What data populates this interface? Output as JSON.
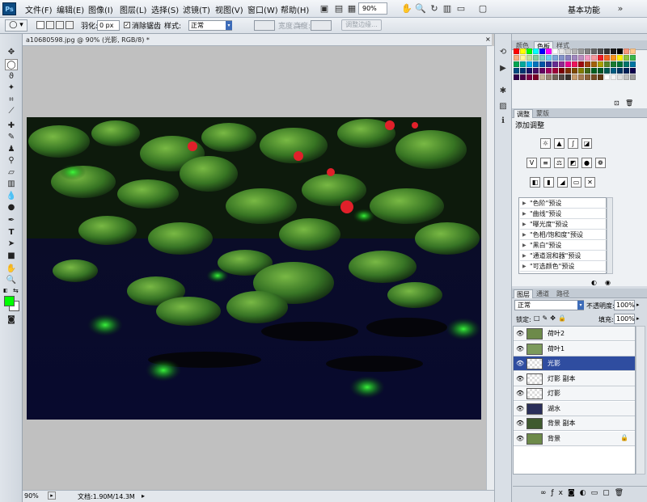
{
  "app": {
    "logo": "Ps"
  },
  "menu": [
    "文件(F)",
    "编辑(E)",
    "图像(I)",
    "图层(L)",
    "选择(S)",
    "滤镜(T)",
    "视图(V)",
    "窗口(W)",
    "帮助(H)"
  ],
  "toolbar": {
    "zoom": "90%",
    "workspace": "基本功能"
  },
  "options": {
    "feather_label": "羽化:",
    "feather_value": "0 px",
    "antialias_label": "消除锯齿",
    "style_label": "样式:",
    "style_value": "正常",
    "width_label": "宽度:",
    "height_label": "高度:",
    "refine_edge": "调整边缘..."
  },
  "document": {
    "tab_title": "a10680598.jpg @ 90% (光影, RGB/8) *",
    "status_zoom": "90%",
    "status_doc": "文档:1.90M/14.3M"
  },
  "panels": {
    "color_tabs": [
      "颜色",
      "色板",
      "样式"
    ],
    "adjust_tabs": [
      "调整",
      "蒙版"
    ],
    "adjust_title": "添加调整",
    "presets": [
      "\"色阶\"预设",
      "\"曲线\"预设",
      "\"曝光度\"预设",
      "\"色相/饱和度\"预设",
      "\"黑白\"预设",
      "\"通道混和器\"预设",
      "\"可选颜色\"预设"
    ],
    "layer_tabs": [
      "图层",
      "通道",
      "路径"
    ],
    "blend_mode": "正常",
    "opacity_label": "不透明度:",
    "opacity_value": "100%",
    "lock_label": "锁定:",
    "fill_label": "填充:",
    "fill_value": "100%"
  },
  "layers": [
    {
      "name": "荷叶2",
      "thumb": "#6d8a4a",
      "selected": false
    },
    {
      "name": "荷叶1",
      "thumb": "#7c9a5c",
      "selected": false
    },
    {
      "name": "光影",
      "thumb": "checker",
      "selected": true
    },
    {
      "name": "灯影 副本",
      "thumb": "checker",
      "selected": false
    },
    {
      "name": "灯影",
      "thumb": "checker",
      "selected": false
    },
    {
      "name": "湖水",
      "thumb": "#2a2f5a",
      "selected": false
    },
    {
      "name": "背景 副本",
      "thumb": "#3f5a2f",
      "selected": false
    },
    {
      "name": "背景",
      "thumb": "#6d8a4a",
      "selected": false,
      "locked": true
    }
  ],
  "colors": {
    "foreground": "#00ff00",
    "background": "#ffffff",
    "selected_layer": "#2f4da0"
  }
}
